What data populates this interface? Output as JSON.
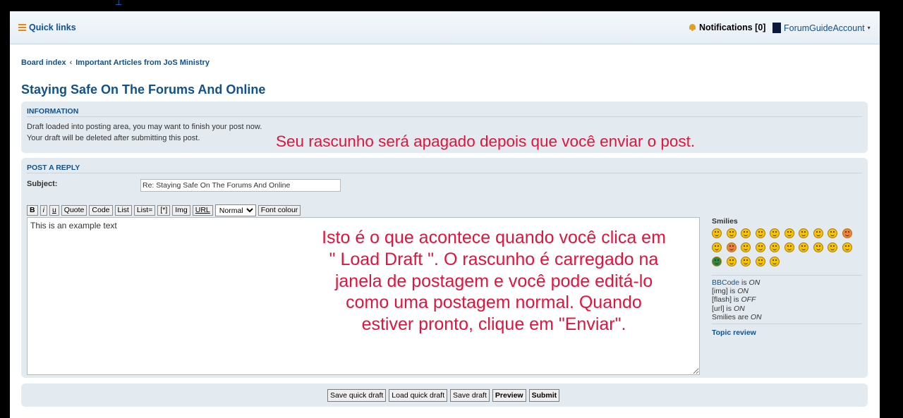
{
  "navbar": {
    "quick_links": "Quick links",
    "notifications": "Notifications [0]",
    "account": "ForumGuideAccount",
    "account_caret": "▾"
  },
  "breadcrumb": {
    "items": [
      "Board index",
      "Important Articles from JoS Ministry"
    ],
    "separator": "‹"
  },
  "topic_title": "Staying Safe On The Forums And Online",
  "information": {
    "heading": "INFORMATION",
    "line1": "Draft loaded into posting area, you may want to finish your post now.",
    "line2": "Your draft will be deleted after submitting this post."
  },
  "post_reply": {
    "heading": "POST A REPLY",
    "subject_label": "Subject:",
    "subject_value": "Re: Staying Safe On The Forums And Online",
    "toolbar": {
      "bold": "B",
      "italic": "i",
      "underline": "u",
      "quote": "Quote",
      "code": "Code",
      "list": "List",
      "list_eq": "List=",
      "list_item": "[*]",
      "img": "Img",
      "url": "URL",
      "font_size": "Normal",
      "font_colour": "Font colour"
    },
    "message": "This is an example text"
  },
  "sidebar": {
    "smilies_title": "Smilies",
    "smilies": [
      "laugh",
      "smile",
      "wink",
      "confused",
      "surprised",
      "eek",
      "rolleyes",
      "cool",
      "razz",
      "mad",
      "tongue",
      "angry",
      "neutral",
      "evil",
      "twisted",
      "sad",
      "exclaim",
      "question",
      "idea",
      "arrow",
      "mrgreen",
      "geek",
      "uber",
      "nerd",
      "sleep"
    ],
    "bbcode": {
      "label": "BBCode",
      "text": " is ",
      "state": "ON"
    },
    "img": {
      "label": "[img]",
      "text": " is ",
      "state": "ON"
    },
    "flash": {
      "label": "[flash]",
      "text": " is ",
      "state": "OFF"
    },
    "url": {
      "label": "[url]",
      "text": " is ",
      "state": "ON"
    },
    "smilies_status": {
      "label": "Smilies",
      "text": " are ",
      "state": "ON"
    },
    "topic_review": "Topic review"
  },
  "actions": {
    "save_quick_draft": "Save quick draft",
    "load_quick_draft": "Load quick draft",
    "save_draft": "Save draft",
    "preview": "Preview",
    "submit": "Submit"
  },
  "annotations": {
    "top": "Seu rascunho será apagado depois que você enviar o post.",
    "main": "Isto é o que acontece quando você clica em \" Load Draft \". O rascunho é carregado na janela de postagem e você pode editá-lo como uma postagem normal. Quando estiver pronto, clique em \"Enviar\"."
  },
  "colors": {
    "link": "#105289",
    "panel": "#e3ebf0",
    "annotation": "#e0143c",
    "accent": "#e08a1e"
  }
}
